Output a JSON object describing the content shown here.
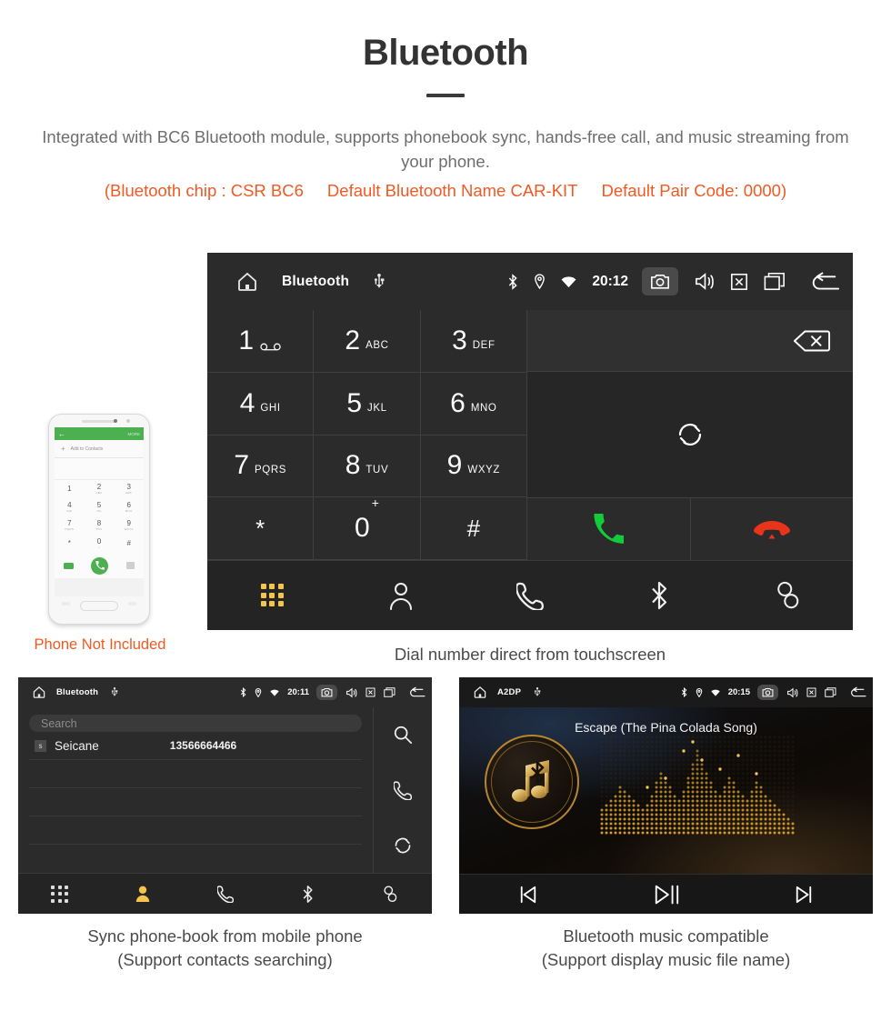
{
  "header": {
    "title": "Bluetooth",
    "subtitle": "Integrated with BC6 Bluetooth module, supports phonebook sync, hands-free call, and music streaming from your phone.",
    "spec_chip": "(Bluetooth chip : CSR BC6",
    "spec_name": "Default Bluetooth Name CAR-KIT",
    "spec_pair": "Default Pair Code: 0000)",
    "accent_color": "#f05a23",
    "body_color": "#6e6e6e"
  },
  "phone_mockup": {
    "note": "Phone Not Included",
    "bar_back": "←",
    "bar_more": "MORE",
    "add_contacts": "Add to Contacts",
    "plus": "+",
    "keys": [
      {
        "num": "1",
        "sub": ""
      },
      {
        "num": "2",
        "sub": "ABC"
      },
      {
        "num": "3",
        "sub": "DEF"
      },
      {
        "num": "4",
        "sub": "GHI"
      },
      {
        "num": "5",
        "sub": "JKL"
      },
      {
        "num": "6",
        "sub": "MNO"
      },
      {
        "num": "7",
        "sub": "PQRS"
      },
      {
        "num": "8",
        "sub": "TUV"
      },
      {
        "num": "9",
        "sub": "WXYZ"
      },
      {
        "num": "*",
        "sub": ""
      },
      {
        "num": "0",
        "sub": "+"
      },
      {
        "num": "#",
        "sub": ""
      }
    ]
  },
  "dialer": {
    "statusbar": {
      "title": "Bluetooth",
      "clock": "20:12",
      "icons": [
        "home-icon",
        "usb-icon",
        "bluetooth-icon",
        "location-icon",
        "wifi-icon",
        "camera-icon",
        "volume-icon",
        "close-icon",
        "recents-icon",
        "back-icon"
      ]
    },
    "keys": [
      {
        "num": "1",
        "sub": "",
        "voicemail": true
      },
      {
        "num": "2",
        "sub": "ABC"
      },
      {
        "num": "3",
        "sub": "DEF"
      },
      {
        "num": "4",
        "sub": "GHI"
      },
      {
        "num": "5",
        "sub": "JKL"
      },
      {
        "num": "6",
        "sub": "MNO"
      },
      {
        "num": "7",
        "sub": "PQRS"
      },
      {
        "num": "8",
        "sub": "TUV"
      },
      {
        "num": "9",
        "sub": "WXYZ"
      },
      {
        "num": "*",
        "sub": ""
      },
      {
        "num": "0",
        "sup": "+"
      },
      {
        "num": "#",
        "sub": ""
      }
    ],
    "actions": {
      "backspace": "backspace-icon",
      "sync": "sync-icon",
      "call": "call-icon",
      "hangup": "hangup-icon",
      "call_color": "#14cc3a",
      "hangup_color": "#e8341a"
    },
    "navbar": [
      "keypad-icon",
      "contacts-icon",
      "call-log-icon",
      "bluetooth-icon",
      "link-icon"
    ],
    "navbar_active": "keypad-icon",
    "active_color": "#f5c44c",
    "caption": "Dial number direct from touchscreen"
  },
  "phonebook": {
    "statusbar": {
      "title": "Bluetooth",
      "clock": "20:11"
    },
    "search_placeholder": "Search",
    "contacts": [
      {
        "badge": "s",
        "name": "Seicane",
        "number": "13566664466"
      }
    ],
    "side_actions": [
      "search-icon",
      "call-icon",
      "sync-icon"
    ],
    "navbar": [
      "keypad-icon",
      "contacts-icon",
      "call-log-icon",
      "bluetooth-icon",
      "link-icon"
    ],
    "navbar_active": "contacts-icon",
    "caption_line1": "Sync phone-book from mobile phone",
    "caption_line2": "(Support contacts searching)"
  },
  "music": {
    "statusbar": {
      "title": "A2DP",
      "clock": "20:15"
    },
    "track_title": "Escape (The Pina Colada Song)",
    "controls": [
      "previous-icon",
      "play-pause-icon",
      "next-icon"
    ],
    "accent_color": "#c9962f",
    "caption_line1": "Bluetooth music compatible",
    "caption_line2": "(Support display music file name)"
  }
}
